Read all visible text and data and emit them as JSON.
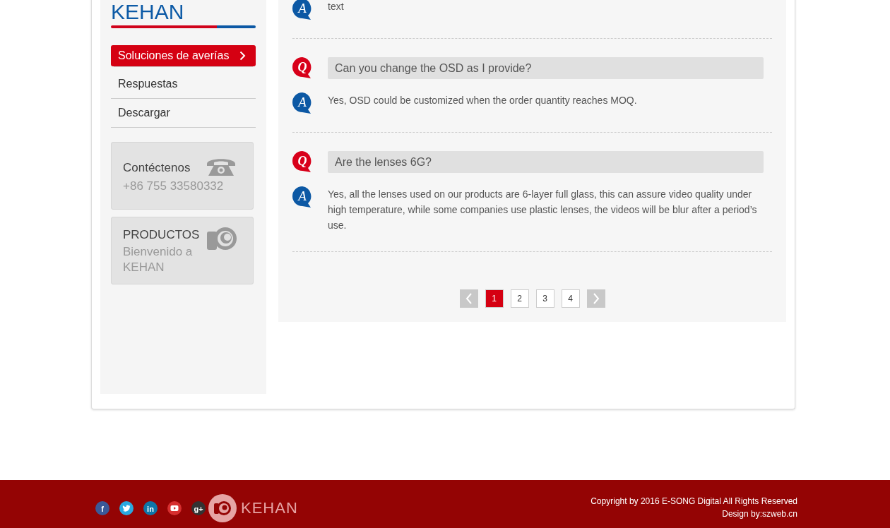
{
  "sidebar": {
    "title": "KEHAN",
    "menu": [
      {
        "label": "Soluciones de averías",
        "selected": true
      },
      {
        "label": "Respuestas",
        "selected": false
      },
      {
        "label": "Descargar",
        "selected": false
      }
    ],
    "contact": {
      "title": "Contéctenos",
      "phone": "+86 755 33580332"
    },
    "products": {
      "title": "PRODUCTOS",
      "subtitle": "Bienvenido a KEHAN"
    }
  },
  "faq": [
    {
      "answer_mark": "A",
      "answer": "text"
    },
    {
      "question_mark": "Q",
      "question": "Can you change the OSD as I provide?",
      "answer_mark": "A",
      "answer": "Yes, OSD could be customized when the order quantity reaches MOQ."
    },
    {
      "question_mark": "Q",
      "question": "Are the lenses 6G?",
      "answer_mark": "A",
      "answer": "Yes, all the lenses used on our products are 6-layer full glass, this can assure video quality under high temperature, while some companies use plastic lenses, the videos will be blur after a period’s use."
    }
  ],
  "pagination": {
    "pages": [
      {
        "label": "1",
        "selected": true
      },
      {
        "label": "2",
        "selected": false
      },
      {
        "label": "3",
        "selected": false
      },
      {
        "label": "4",
        "selected": false
      }
    ]
  },
  "footer": {
    "social": [
      {
        "kind": "facebook",
        "glyph": "f"
      },
      {
        "kind": "twitter"
      },
      {
        "kind": "linkedin",
        "glyph": "in"
      },
      {
        "kind": "youtube"
      },
      {
        "kind": "googleplus",
        "glyph": "g+"
      }
    ],
    "logo": "KEHAN",
    "copyright": "Copyright by 2016 E-SONG Digital All Rights Reserved",
    "design": "Design by:szweb.cn"
  }
}
